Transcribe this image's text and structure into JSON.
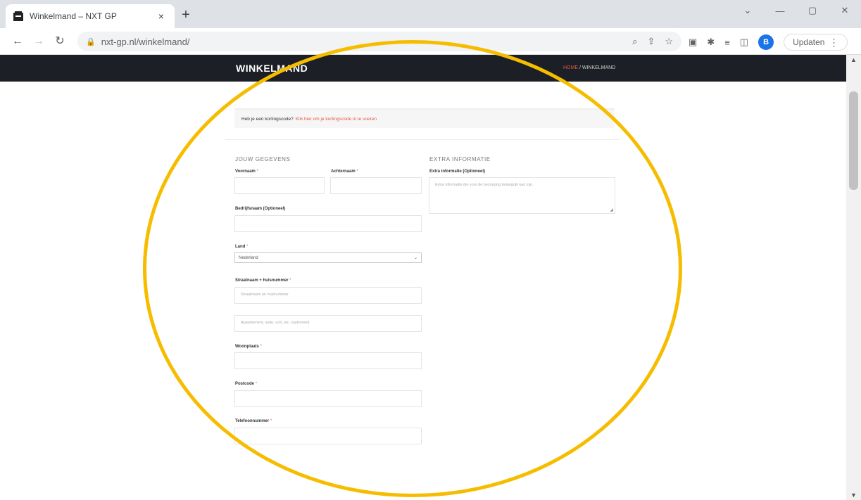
{
  "browser": {
    "tab_title": "Winkelmand – NXT GP",
    "tab_close": "×",
    "new_tab": "+",
    "url": "nxt-gp.nl/winkelmand/",
    "update_label": "Updaten",
    "profile_initial": "B",
    "win_minimize": "—",
    "win_restore": "▢",
    "win_close": "✕",
    "win_chevron": "⌄"
  },
  "header": {
    "site_title": "WINKELMAND",
    "breadcrumb_home": "HOME",
    "breadcrumb_sep": " / ",
    "breadcrumb_current": "WINKELMAND"
  },
  "coupon": {
    "question": "Heb je een kortingscode?",
    "link": "Klik hier om je kortingscode in te voeren"
  },
  "billing": {
    "title": "JOUW GEGEVENS",
    "first_name_label": "Voornaam",
    "last_name_label": "Achternaam",
    "company_label": "Bedrijfsnaam (Optioneel)",
    "country_label": "Land",
    "country_value": "Nederland",
    "street_label": "Straatnaam + huisnummer",
    "street_placeholder": "Straatnaam en huisnummer",
    "street2_placeholder": "Appartement, suite, unit, etc. (optioneel)",
    "city_label": "Woonplaats",
    "postcode_label": "Postcode",
    "phone_label": "Telefoonnummer",
    "required_mark": "*"
  },
  "extra": {
    "title": "EXTRA INFORMATIE",
    "notes_label": "Extra informatie (Optioneel)",
    "notes_placeholder": "Extra informatie die voor de bezorging belangrijk kan zijn."
  },
  "colors": {
    "header_bg": "#1c1f25",
    "accent": "#e0584a",
    "annotation": "#f6bd00"
  }
}
